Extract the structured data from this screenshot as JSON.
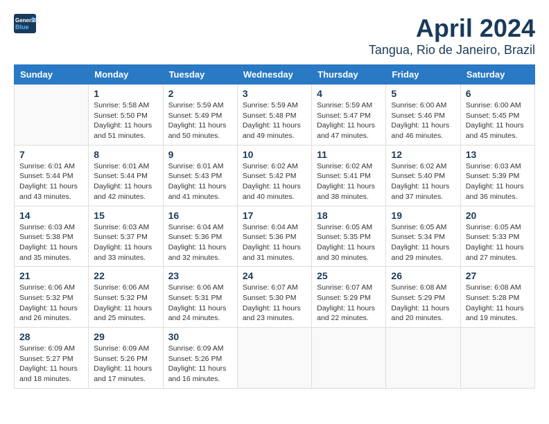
{
  "logo": {
    "line1": "General",
    "line2": "Blue"
  },
  "title": "April 2024",
  "subtitle": "Tangua, Rio de Janeiro, Brazil",
  "days_header": [
    "Sunday",
    "Monday",
    "Tuesday",
    "Wednesday",
    "Thursday",
    "Friday",
    "Saturday"
  ],
  "weeks": [
    [
      {
        "day": "",
        "info": ""
      },
      {
        "day": "1",
        "info": "Sunrise: 5:58 AM\nSunset: 5:50 PM\nDaylight: 11 hours\nand 51 minutes."
      },
      {
        "day": "2",
        "info": "Sunrise: 5:59 AM\nSunset: 5:49 PM\nDaylight: 11 hours\nand 50 minutes."
      },
      {
        "day": "3",
        "info": "Sunrise: 5:59 AM\nSunset: 5:48 PM\nDaylight: 11 hours\nand 49 minutes."
      },
      {
        "day": "4",
        "info": "Sunrise: 5:59 AM\nSunset: 5:47 PM\nDaylight: 11 hours\nand 47 minutes."
      },
      {
        "day": "5",
        "info": "Sunrise: 6:00 AM\nSunset: 5:46 PM\nDaylight: 11 hours\nand 46 minutes."
      },
      {
        "day": "6",
        "info": "Sunrise: 6:00 AM\nSunset: 5:45 PM\nDaylight: 11 hours\nand 45 minutes."
      }
    ],
    [
      {
        "day": "7",
        "info": "Sunrise: 6:01 AM\nSunset: 5:44 PM\nDaylight: 11 hours\nand 43 minutes."
      },
      {
        "day": "8",
        "info": "Sunrise: 6:01 AM\nSunset: 5:44 PM\nDaylight: 11 hours\nand 42 minutes."
      },
      {
        "day": "9",
        "info": "Sunrise: 6:01 AM\nSunset: 5:43 PM\nDaylight: 11 hours\nand 41 minutes."
      },
      {
        "day": "10",
        "info": "Sunrise: 6:02 AM\nSunset: 5:42 PM\nDaylight: 11 hours\nand 40 minutes."
      },
      {
        "day": "11",
        "info": "Sunrise: 6:02 AM\nSunset: 5:41 PM\nDaylight: 11 hours\nand 38 minutes."
      },
      {
        "day": "12",
        "info": "Sunrise: 6:02 AM\nSunset: 5:40 PM\nDaylight: 11 hours\nand 37 minutes."
      },
      {
        "day": "13",
        "info": "Sunrise: 6:03 AM\nSunset: 5:39 PM\nDaylight: 11 hours\nand 36 minutes."
      }
    ],
    [
      {
        "day": "14",
        "info": "Sunrise: 6:03 AM\nSunset: 5:38 PM\nDaylight: 11 hours\nand 35 minutes."
      },
      {
        "day": "15",
        "info": "Sunrise: 6:03 AM\nSunset: 5:37 PM\nDaylight: 11 hours\nand 33 minutes."
      },
      {
        "day": "16",
        "info": "Sunrise: 6:04 AM\nSunset: 5:36 PM\nDaylight: 11 hours\nand 32 minutes."
      },
      {
        "day": "17",
        "info": "Sunrise: 6:04 AM\nSunset: 5:36 PM\nDaylight: 11 hours\nand 31 minutes."
      },
      {
        "day": "18",
        "info": "Sunrise: 6:05 AM\nSunset: 5:35 PM\nDaylight: 11 hours\nand 30 minutes."
      },
      {
        "day": "19",
        "info": "Sunrise: 6:05 AM\nSunset: 5:34 PM\nDaylight: 11 hours\nand 29 minutes."
      },
      {
        "day": "20",
        "info": "Sunrise: 6:05 AM\nSunset: 5:33 PM\nDaylight: 11 hours\nand 27 minutes."
      }
    ],
    [
      {
        "day": "21",
        "info": "Sunrise: 6:06 AM\nSunset: 5:32 PM\nDaylight: 11 hours\nand 26 minutes."
      },
      {
        "day": "22",
        "info": "Sunrise: 6:06 AM\nSunset: 5:32 PM\nDaylight: 11 hours\nand 25 minutes."
      },
      {
        "day": "23",
        "info": "Sunrise: 6:06 AM\nSunset: 5:31 PM\nDaylight: 11 hours\nand 24 minutes."
      },
      {
        "day": "24",
        "info": "Sunrise: 6:07 AM\nSunset: 5:30 PM\nDaylight: 11 hours\nand 23 minutes."
      },
      {
        "day": "25",
        "info": "Sunrise: 6:07 AM\nSunset: 5:29 PM\nDaylight: 11 hours\nand 22 minutes."
      },
      {
        "day": "26",
        "info": "Sunrise: 6:08 AM\nSunset: 5:29 PM\nDaylight: 11 hours\nand 20 minutes."
      },
      {
        "day": "27",
        "info": "Sunrise: 6:08 AM\nSunset: 5:28 PM\nDaylight: 11 hours\nand 19 minutes."
      }
    ],
    [
      {
        "day": "28",
        "info": "Sunrise: 6:09 AM\nSunset: 5:27 PM\nDaylight: 11 hours\nand 18 minutes."
      },
      {
        "day": "29",
        "info": "Sunrise: 6:09 AM\nSunset: 5:26 PM\nDaylight: 11 hours\nand 17 minutes."
      },
      {
        "day": "30",
        "info": "Sunrise: 6:09 AM\nSunset: 5:26 PM\nDaylight: 11 hours\nand 16 minutes."
      },
      {
        "day": "",
        "info": ""
      },
      {
        "day": "",
        "info": ""
      },
      {
        "day": "",
        "info": ""
      },
      {
        "day": "",
        "info": ""
      }
    ]
  ]
}
